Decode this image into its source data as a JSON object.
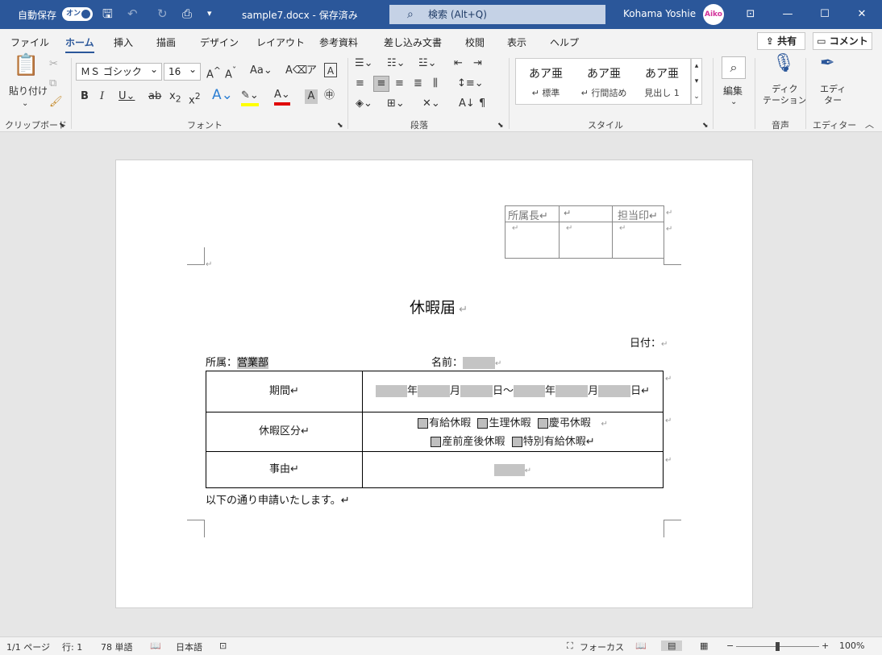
{
  "titlebar": {
    "autosave_label": "自動保存",
    "autosave_toggle": "オン",
    "doc_title": "sample7.docx - 保存済み",
    "search_placeholder": "検索 (Alt+Q)",
    "user_name": "Kohama Yoshie",
    "avatar_text": "Aiko",
    "accent_color": "#2b579a"
  },
  "tabs": [
    "ファイル",
    "ホーム",
    "挿入",
    "描画",
    "デザイン",
    "レイアウト",
    "参考資料",
    "差し込み文書",
    "校閲",
    "表示",
    "ヘルプ"
  ],
  "active_tab": "ホーム",
  "share_label": "共有",
  "comment_label": "コメント",
  "ribbon": {
    "clipboard": {
      "paste_label": "貼り付け",
      "group_label": "クリップボード"
    },
    "font": {
      "font_name": "ＭＳ ゴシック",
      "font_size": "16",
      "group_label": "フォント"
    },
    "paragraph": {
      "group_label": "段落"
    },
    "styles": {
      "items": [
        {
          "preview": "あア亜",
          "name": "↵ 標準"
        },
        {
          "preview": "あア亜",
          "name": "↵ 行間詰め"
        },
        {
          "preview": "あア亜",
          "name": "見出し 1"
        }
      ],
      "group_label": "スタイル"
    },
    "editing": {
      "label": "編集"
    },
    "voice": {
      "label": "ディク\nテーション",
      "group_label": "音声"
    },
    "editor": {
      "label": "エディ\nター",
      "group_label": "エディター"
    }
  },
  "document": {
    "stamp_headers": [
      "所属長↵",
      "↵",
      "担当印↵"
    ],
    "stamp_cells": [
      "↵",
      "↵",
      "↵"
    ],
    "title": "休暇届",
    "date_label": "日付：",
    "dept_label": "所属：",
    "dept_value": "営業部",
    "name_label": "名前：",
    "rows": [
      {
        "label": "期間↵"
      },
      {
        "label": "休暇区分↵"
      },
      {
        "label": "事由↵"
      }
    ],
    "period": {
      "year": "年",
      "month": "月",
      "day": "日～",
      "day_end": "日↵"
    },
    "leave_types_row1": [
      "有給休暇",
      "生理休暇",
      "慶弔休暇"
    ],
    "leave_types_row2": [
      "産前産後休暇",
      "特別有給休暇↵"
    ],
    "footer_text": "以下の通り申請いたします。↵"
  },
  "status": {
    "page": "1/1 ページ",
    "line": "行: 1",
    "words": "78 単語",
    "language": "日本語",
    "focus": "フォーカス",
    "zoom_percent": "100%",
    "zoom_level": 1.0
  }
}
